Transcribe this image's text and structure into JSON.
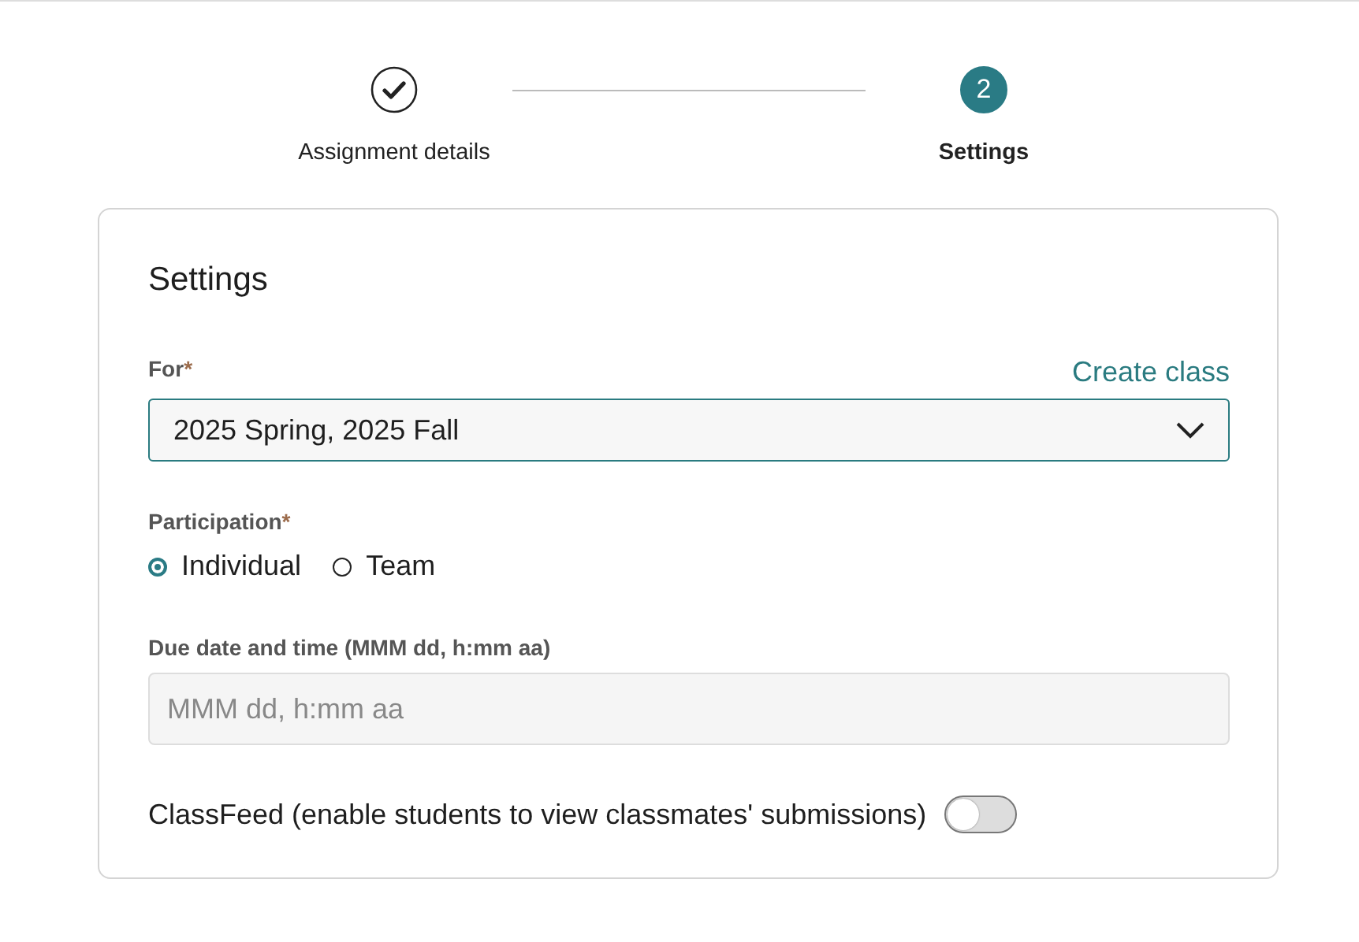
{
  "stepper": [
    {
      "label": "Assignment details",
      "completed": true,
      "selected": false
    },
    {
      "label": "Settings",
      "number": "2",
      "completed": false,
      "selected": true
    }
  ],
  "card": {
    "title": "Settings",
    "for_field": {
      "label": "For",
      "required_mark": "*",
      "link": "Create class",
      "value": "2025 Spring, 2025 Fall"
    },
    "participation": {
      "label": "Participation",
      "required_mark": "*",
      "options": [
        {
          "label": "Individual",
          "selected": true
        },
        {
          "label": "Team",
          "selected": false
        }
      ]
    },
    "due_date": {
      "label": "Due date and time (MMM dd, h:mm aa)",
      "placeholder": "MMM dd, h:mm aa"
    },
    "classfeed": {
      "label": "ClassFeed (enable students to view classmates' submissions)",
      "on": false
    }
  }
}
